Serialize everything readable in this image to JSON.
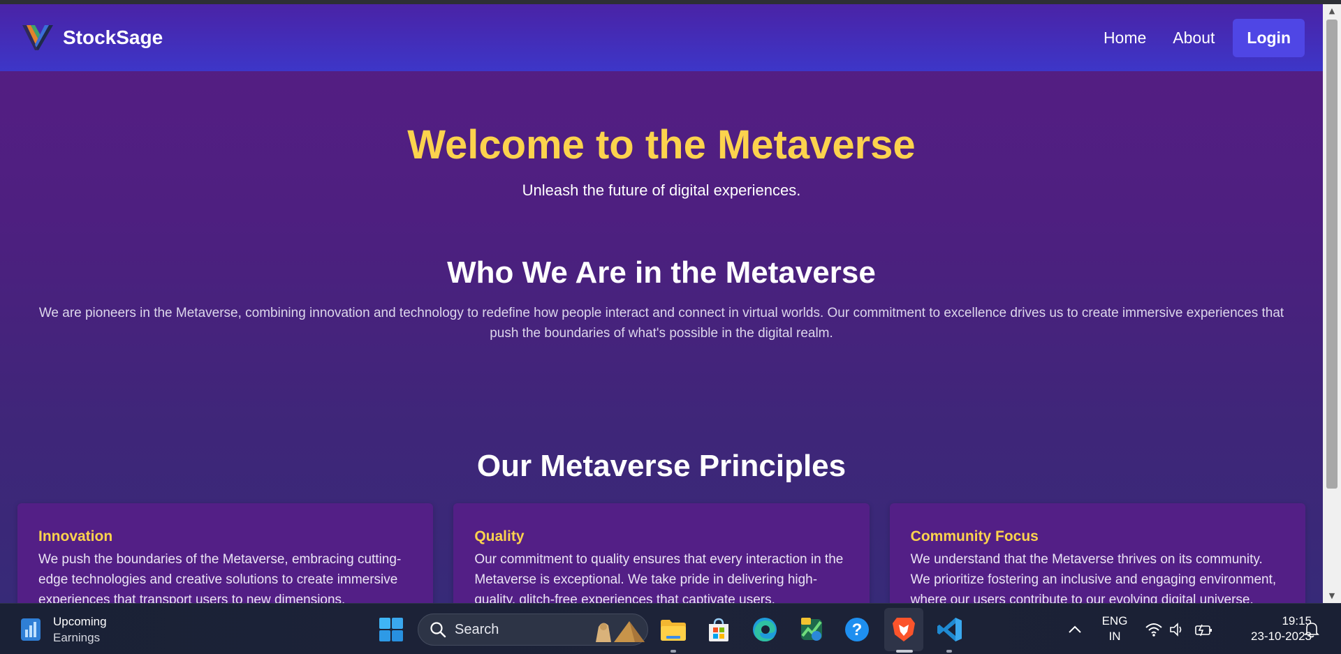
{
  "navbar": {
    "brand": "StockSage",
    "links": [
      "Home",
      "About"
    ],
    "login_label": "Login"
  },
  "hero": {
    "title": "Welcome to the Metaverse",
    "subtitle": "Unleash the future of digital experiences."
  },
  "about": {
    "title": "Who We Are in the Metaverse",
    "text": "We are pioneers in the Metaverse, combining innovation and technology to redefine how people interact and connect in virtual worlds. Our commitment to excellence drives us to create immersive experiences that push the boundaries of what's possible in the digital realm."
  },
  "principles": {
    "title": "Our Metaverse Principles",
    "cards": [
      {
        "title": "Innovation",
        "text": "We push the boundaries of the Metaverse, embracing cutting-edge technologies and creative solutions to create immersive experiences that transport users to new dimensions."
      },
      {
        "title": "Quality",
        "text": "Our commitment to quality ensures that every interaction in the Metaverse is exceptional. We take pride in delivering high-quality, glitch-free experiences that captivate users."
      },
      {
        "title": "Community Focus",
        "text": "We understand that the Metaverse thrives on its community. We prioritize fostering an inclusive and engaging environment, where our users contribute to our evolving digital universe."
      }
    ]
  },
  "taskbar": {
    "widget": {
      "title": "Upcoming",
      "subtitle": "Earnings"
    },
    "search_placeholder": "Search",
    "language": {
      "line1": "ENG",
      "line2": "IN"
    },
    "clock": {
      "time": "19:15",
      "date": "23-10-2023"
    },
    "icons": [
      "windows-start-icon",
      "file-explorer-icon",
      "microsoft-store-icon",
      "edge-browser-icon",
      "stock-app-icon",
      "help-icon",
      "brave-browser-icon",
      "vscode-icon"
    ]
  },
  "colors": {
    "accent_yellow": "#fcd34d",
    "login_button": "#4f46e5",
    "navbar": "#3d36c8",
    "page_bg": "#4e1f80",
    "card_bg": "#531f86"
  }
}
